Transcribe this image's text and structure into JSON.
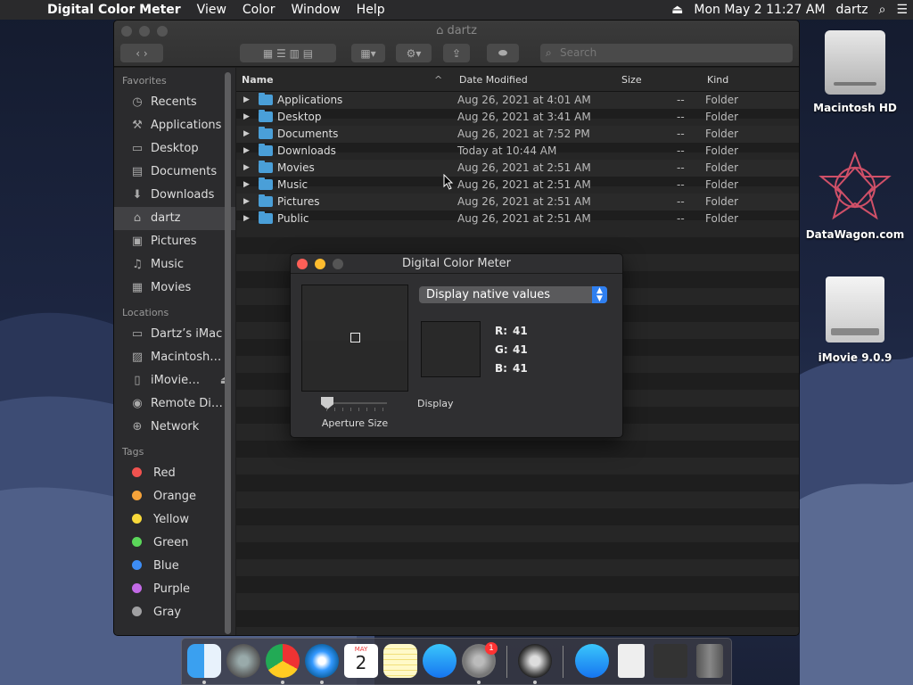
{
  "menubar": {
    "app_name": "Digital Color Meter",
    "menus": [
      "View",
      "Color",
      "Window",
      "Help"
    ],
    "datetime": "Mon May 2  11:27 AM",
    "user": "dartz"
  },
  "finder": {
    "title": "dartz",
    "search_placeholder": "Search",
    "sidebar": {
      "favorites_header": "Favorites",
      "favorites": [
        {
          "label": "Recents",
          "icon": "recents-icon"
        },
        {
          "label": "Applications",
          "icon": "applications-icon"
        },
        {
          "label": "Desktop",
          "icon": "desktop-icon"
        },
        {
          "label": "Documents",
          "icon": "documents-icon"
        },
        {
          "label": "Downloads",
          "icon": "downloads-icon"
        },
        {
          "label": "dartz",
          "icon": "home-icon"
        },
        {
          "label": "Pictures",
          "icon": "pictures-icon"
        },
        {
          "label": "Music",
          "icon": "music-icon"
        },
        {
          "label": "Movies",
          "icon": "movies-icon"
        }
      ],
      "locations_header": "Locations",
      "locations": [
        {
          "label": "Dartz’s iMac",
          "icon": "imac-icon"
        },
        {
          "label": "Macintosh…",
          "icon": "disk-icon"
        },
        {
          "label": "iMovie…",
          "icon": "disk-image-icon"
        },
        {
          "label": "Remote Di…",
          "icon": "remote-disc-icon"
        },
        {
          "label": "Network",
          "icon": "network-icon"
        }
      ],
      "tags_header": "Tags",
      "tags": [
        {
          "label": "Red",
          "color": "#f0524f"
        },
        {
          "label": "Orange",
          "color": "#f6a33a"
        },
        {
          "label": "Yellow",
          "color": "#f8d93a"
        },
        {
          "label": "Green",
          "color": "#5bd75a"
        },
        {
          "label": "Blue",
          "color": "#3d8df5"
        },
        {
          "label": "Purple",
          "color": "#c36ae6"
        },
        {
          "label": "Gray",
          "color": "#a0a0a2"
        }
      ]
    },
    "columns": {
      "name": "Name",
      "date": "Date Modified",
      "size": "Size",
      "kind": "Kind"
    },
    "rows": [
      {
        "name": "Applications",
        "date": "Aug 26, 2021 at 4:01 AM",
        "size": "--",
        "kind": "Folder"
      },
      {
        "name": "Desktop",
        "date": "Aug 26, 2021 at 3:41 AM",
        "size": "--",
        "kind": "Folder"
      },
      {
        "name": "Documents",
        "date": "Aug 26, 2021 at 7:52 PM",
        "size": "--",
        "kind": "Folder"
      },
      {
        "name": "Downloads",
        "date": "Today at 10:44 AM",
        "size": "--",
        "kind": "Folder"
      },
      {
        "name": "Movies",
        "date": "Aug 26, 2021 at 2:51 AM",
        "size": "--",
        "kind": "Folder"
      },
      {
        "name": "Music",
        "date": "Aug 26, 2021 at 2:51 AM",
        "size": "--",
        "kind": "Folder"
      },
      {
        "name": "Pictures",
        "date": "Aug 26, 2021 at 2:51 AM",
        "size": "--",
        "kind": "Folder"
      },
      {
        "name": "Public",
        "date": "Aug 26, 2021 at 2:51 AM",
        "size": "--",
        "kind": "Folder"
      }
    ]
  },
  "dcm": {
    "title": "Digital Color Meter",
    "mode": "Display native values",
    "r_label": "R:",
    "r": "41",
    "g_label": "G:",
    "g": "41",
    "b_label": "B:",
    "b": "41",
    "aperture_label": "Aperture Size",
    "display_label": "Display",
    "sampled_color": "#292929"
  },
  "desktop": {
    "icons": [
      {
        "label": "Macintosh HD",
        "icon": "hard-disk-icon"
      },
      {
        "label": "DataWagon.com",
        "icon": "datawagon-logo-icon"
      },
      {
        "label": "iMovie 9.0.9",
        "icon": "disk-image-icon"
      }
    ]
  },
  "dock": {
    "apps": [
      "finder-icon",
      "launchpad-icon",
      "chrome-icon",
      "safari-icon",
      "calendar-icon",
      "notes-icon",
      "app-store-icon",
      "system-preferences-icon",
      "digital-color-meter-icon",
      "app-store-downloads-icon",
      "document-icon",
      "screenshot-icon",
      "trash-icon"
    ],
    "calendar_month": "MAY",
    "calendar_day": "2",
    "badge": "1"
  }
}
